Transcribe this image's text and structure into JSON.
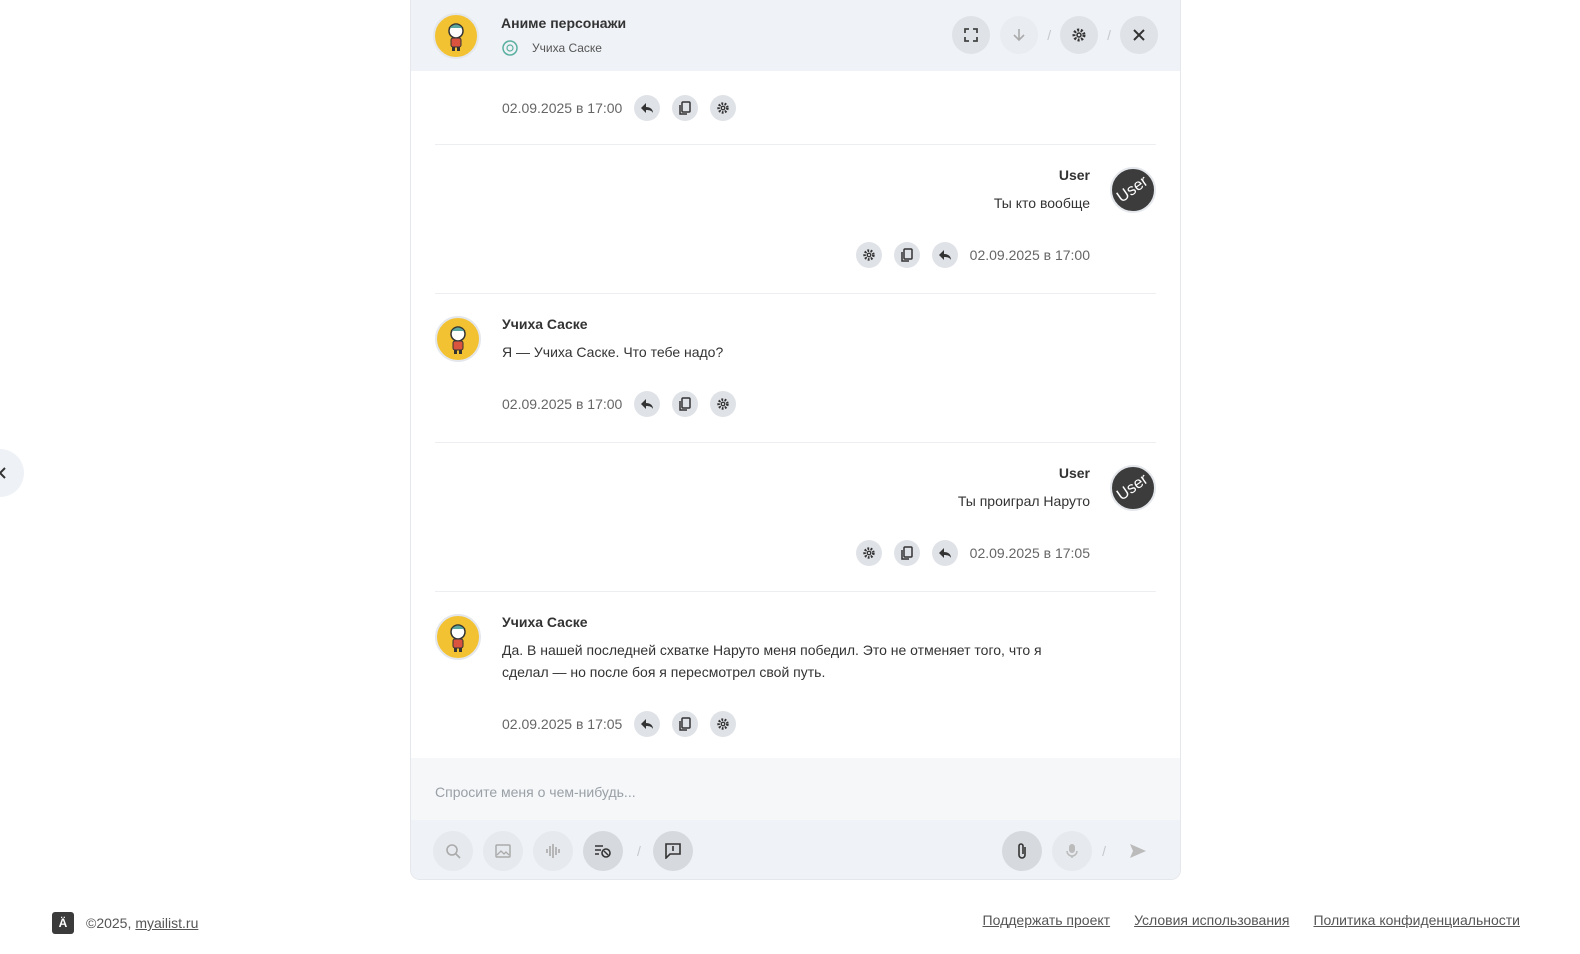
{
  "header": {
    "title": "Аниме персонажи",
    "character": "Учиха Саске"
  },
  "messages": [
    {
      "author": "",
      "text": "",
      "time": "02.09.2025 в 17:00",
      "side": "bot"
    },
    {
      "author": "User",
      "text": "Ты кто вообще",
      "time": "02.09.2025 в 17:00",
      "side": "user",
      "avatar_label": "User"
    },
    {
      "author": "Учиха Саске",
      "text": "Я — Учиха Саске. Что тебе надо?",
      "time": "02.09.2025 в 17:00",
      "side": "bot"
    },
    {
      "author": "User",
      "text": "Ты проиграл Наруто",
      "time": "02.09.2025 в 17:05",
      "side": "user",
      "avatar_label": "User"
    },
    {
      "author": "Учиха Саске",
      "text_line1": "Да. В нашей последней схватке Наруто меня победил. Это не отменяет того, что я",
      "text_line2": "сделал — но после боя я пересмотрел свой путь.",
      "time": "02.09.2025 в 17:05",
      "side": "bot"
    }
  ],
  "input": {
    "placeholder": "Спросите меня о чем-нибудь..."
  },
  "footer": {
    "copyright": "©2025,",
    "site": "myailist.ru",
    "links": [
      "Поддержать проект",
      "Условия использования",
      "Политика конфиденциальности"
    ]
  },
  "icons": {
    "expand": "expand-icon",
    "scroll_down": "arrow-down-icon",
    "settings": "gear-icon",
    "close": "close-icon",
    "reply": "reply-icon",
    "copy": "copy-icon",
    "attach": "paperclip-icon",
    "mic": "microphone-icon",
    "send": "send-icon"
  },
  "colors": {
    "bot_avatar": "#f2c233",
    "user_avatar": "#3c3c3c",
    "header_bg": "#eff2f6"
  }
}
